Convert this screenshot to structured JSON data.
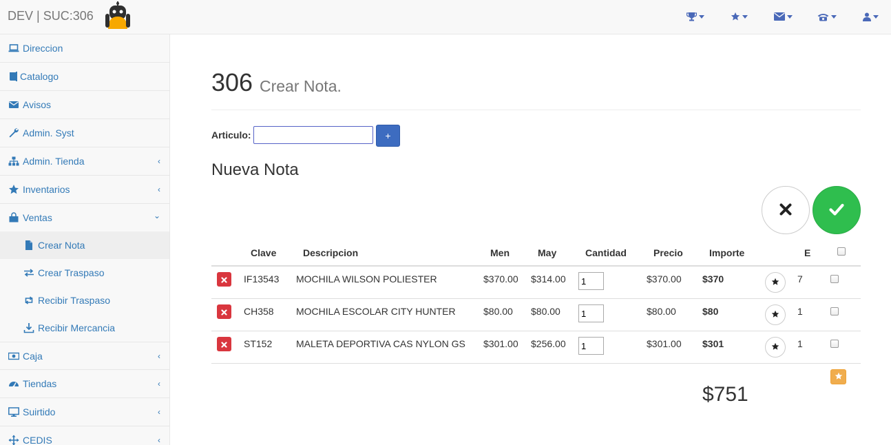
{
  "header": {
    "brand": "DEV | SUC:306",
    "icons": [
      "trophy-icon",
      "star-icon",
      "envelope-icon",
      "phone-icon",
      "user-icon"
    ]
  },
  "sidebar": {
    "items": [
      {
        "label": "Direccion",
        "icon": "laptop-icon",
        "chevron": ""
      },
      {
        "label": "Catalogo",
        "icon": "book-icon",
        "chevron": ""
      },
      {
        "label": "Avisos",
        "icon": "envelope-icon",
        "chevron": ""
      },
      {
        "label": "Admin. Syst",
        "icon": "wrench-icon",
        "chevron": ""
      },
      {
        "label": "Admin. Tienda",
        "icon": "sitemap-icon",
        "chevron": "‹"
      },
      {
        "label": "Inventarios",
        "icon": "star-icon",
        "chevron": "‹"
      },
      {
        "label": "Ventas",
        "icon": "shopping-bag-icon",
        "chevron": "⌄"
      }
    ],
    "subitems": [
      {
        "label": "Crear Nota",
        "icon": "file-icon"
      },
      {
        "label": "Crear Traspaso",
        "icon": "exchange-icon"
      },
      {
        "label": "Recibir Traspaso",
        "icon": "retweet-icon"
      },
      {
        "label": "Recibir Mercancia",
        "icon": "download-icon"
      }
    ],
    "items_after": [
      {
        "label": "Caja",
        "icon": "money-icon",
        "chevron": "‹"
      },
      {
        "label": "Tiendas",
        "icon": "dashboard-icon",
        "chevron": "‹"
      },
      {
        "label": "Suirtido",
        "icon": "desktop-icon",
        "chevron": "‹"
      },
      {
        "label": "CEDIS",
        "icon": "arrows-icon",
        "chevron": "‹"
      }
    ]
  },
  "page": {
    "number": "306",
    "subtitle": "Crear Nota.",
    "articulo_label": "Articulo:",
    "articulo_value": "",
    "add_label": "+",
    "section_title": "Nueva Nota"
  },
  "table": {
    "headers": {
      "clave": "Clave",
      "descripcion": "Descripcion",
      "men": "Men",
      "may": "May",
      "cantidad": "Cantidad",
      "precio": "Precio",
      "importe": "Importe",
      "e": "E"
    },
    "rows": [
      {
        "clave": "IF13543",
        "descripcion": "MOCHILA WILSON POLIESTER",
        "men": "$370.00",
        "may": "$314.00",
        "cantidad": "1",
        "precio": "$370.00",
        "importe": "$370",
        "e": "7"
      },
      {
        "clave": "CH358",
        "descripcion": "MOCHILA ESCOLAR CITY HUNTER",
        "men": "$80.00",
        "may": "$80.00",
        "cantidad": "1",
        "precio": "$80.00",
        "importe": "$80",
        "e": "1"
      },
      {
        "clave": "ST152",
        "descripcion": "MALETA DEPORTIVA CAS NYLON GS",
        "men": "$301.00",
        "may": "$256.00",
        "cantidad": "1",
        "precio": "$301.00",
        "importe": "$301",
        "e": "1"
      }
    ],
    "total": "$751"
  },
  "colors": {
    "link": "#337ab7",
    "navIcon": "#4a69b8",
    "danger": "#d9363e",
    "success": "#2fbe4e",
    "warning": "#f0ad4e",
    "primary": "#3d6cc0"
  }
}
